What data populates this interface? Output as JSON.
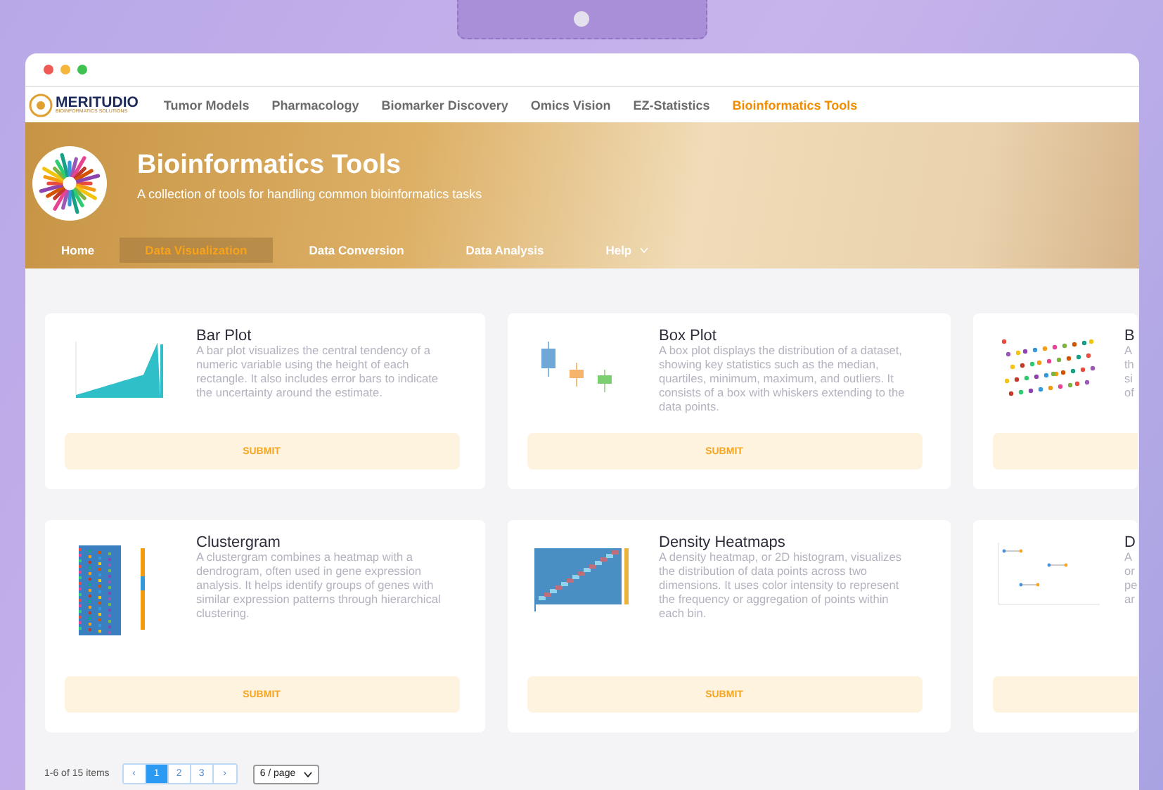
{
  "brand": {
    "name": "MERITUDIO",
    "tagline": "BIOINFORMATICS SOLUTIONS"
  },
  "nav": [
    {
      "label": "Tumor Models",
      "selected": false
    },
    {
      "label": "Pharmacology",
      "selected": false
    },
    {
      "label": "Biomarker Discovery",
      "selected": false
    },
    {
      "label": "Omics Vision",
      "selected": false
    },
    {
      "label": "EZ-Statistics",
      "selected": false
    },
    {
      "label": "Bioinformatics Tools",
      "selected": true
    }
  ],
  "banner": {
    "title": "Bioinformatics Tools",
    "subtitle": "A collection of tools for handling common bioinformatics tasks"
  },
  "tabs": [
    {
      "label": "Home",
      "selected": false,
      "dropdown": false
    },
    {
      "label": "Data Visualization",
      "selected": true,
      "dropdown": false
    },
    {
      "label": "Data Conversion",
      "selected": false,
      "dropdown": false
    },
    {
      "label": "Data Analysis",
      "selected": false,
      "dropdown": false
    },
    {
      "label": "Help",
      "selected": false,
      "dropdown": true
    }
  ],
  "cards": [
    {
      "kind": "bar",
      "title": "Bar Plot",
      "description": [
        "A bar plot visualizes the central tendency of a numeric variable using the height of each rectangle. It also includes error bars to indicate the uncertainty around the estimate."
      ],
      "button": "SUBMIT"
    },
    {
      "kind": "box",
      "title": "Box Plot",
      "description": [
        "A box plot displays the distribution of a dataset, showing key statistics such as the median, quartiles, minimum, maximum, and outliers. It consists of a box with whiskers extending to the data points."
      ],
      "button": "SUBMIT"
    },
    {
      "kind": "scatter",
      "title": "B",
      "description": [
        "A",
        "th",
        "si",
        "of"
      ]
    },
    {
      "kind": "cluster",
      "title": "Clustergram",
      "description": [
        "A clustergram combines a heatmap with a dendrogram, often used in gene expression analysis. It helps identify groups of genes with similar expression patterns through hierarchical clustering."
      ],
      "button": "SUBMIT"
    },
    {
      "kind": "heatmap",
      "title": "Density Heatmaps",
      "description": [
        "A density heatmap, or 2D histogram, visualizes the distribution of data points across two dimensions. It uses color intensity to represent the frequency or aggregation of points within each bin."
      ],
      "button": "SUBMIT"
    },
    {
      "kind": "dumbbell",
      "title": "D",
      "description": [
        "A",
        "or",
        "pe",
        "ar"
      ]
    }
  ],
  "pagination": {
    "summary": "1-6 of 15 items",
    "prev": "‹",
    "pages": [
      {
        "label": "1",
        "selected": true
      },
      {
        "label": "2",
        "selected": false
      },
      {
        "label": "3",
        "selected": false
      }
    ],
    "next": "›",
    "page_size": "6 / page"
  }
}
